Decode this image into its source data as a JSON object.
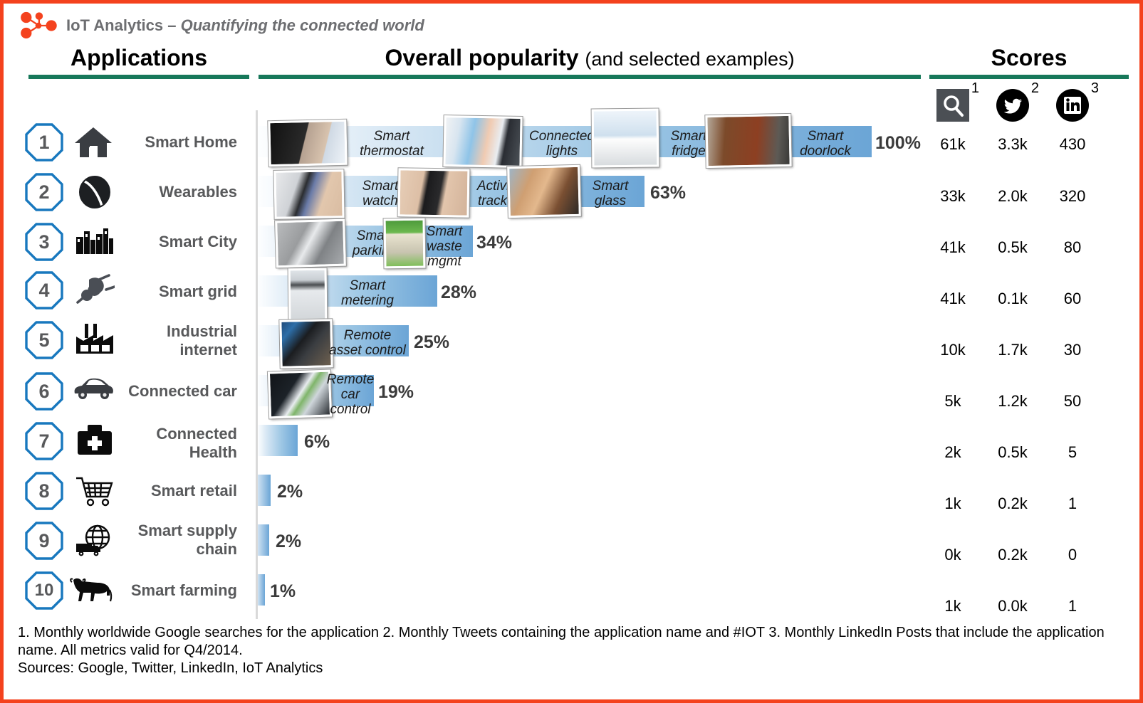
{
  "brand": {
    "logo_icon": "iot-analytics-node-logo",
    "name": "IoT Analytics – ",
    "tagline": "Quantifying the connected world"
  },
  "headers": {
    "applications": "Applications",
    "popularity_main": "Overall popularity",
    "popularity_sub": "(and selected examples)",
    "scores": "Scores"
  },
  "score_columns": [
    {
      "icon": "google-search-icon",
      "footnote": "1"
    },
    {
      "icon": "twitter-bird-icon",
      "footnote": "2"
    },
    {
      "icon": "linkedin-icon",
      "footnote": "3"
    }
  ],
  "chart_data": {
    "type": "bar",
    "title": "Overall popularity (and selected examples)",
    "xlabel": "",
    "ylabel": "",
    "xlim": [
      0,
      100
    ],
    "grid": false,
    "legend": "none",
    "categories": [
      "Smart Home",
      "Wearables",
      "Smart City",
      "Smart grid",
      "Industrial internet",
      "Connected car",
      "Connected Health",
      "Smart retail",
      "Smart supply chain",
      "Smart farming"
    ],
    "values": [
      100,
      63,
      34,
      28,
      25,
      19,
      6,
      2,
      2,
      1
    ],
    "value_labels": [
      "100%",
      "63%",
      "34%",
      "28%",
      "25%",
      "19%",
      "6%",
      "2%",
      "2%",
      "1%"
    ],
    "series": [
      {
        "name": "Google searches (monthly)",
        "values": [
          "61k",
          "33k",
          "41k",
          "41k",
          "10k",
          "5k",
          "2k",
          "1k",
          "0k",
          "1k"
        ]
      },
      {
        "name": "Tweets (monthly)",
        "values": [
          "3.3k",
          "2.0k",
          "0.5k",
          "0.1k",
          "1.7k",
          "1.2k",
          "0.5k",
          "0.2k",
          "0.2k",
          "0.0k"
        ]
      },
      {
        "name": "LinkedIn posts (monthly)",
        "values": [
          "430",
          "320",
          "80",
          "60",
          "30",
          "50",
          "5",
          "1",
          "0",
          "1"
        ]
      }
    ]
  },
  "rows": [
    {
      "rank": "1",
      "label": "Smart Home",
      "icon": "house-icon",
      "pct": "100%",
      "pct_value": 100,
      "scores": [
        "61k",
        "3.3k",
        "430"
      ],
      "examples": [
        {
          "label": "Smart\nthermostat",
          "photo": "smart-thermostat-photo"
        },
        {
          "label": "Connected\nlights",
          "photo": "connected-lights-photo"
        },
        {
          "label": "Smart\nfridge",
          "photo": "smart-fridge-photo"
        },
        {
          "label": "Smart\ndoorlock",
          "photo": "smart-doorlock-photo"
        }
      ]
    },
    {
      "rank": "2",
      "label": "Wearables",
      "icon": "smartwatch-band-icon",
      "pct": "63%",
      "pct_value": 63,
      "scores": [
        "33k",
        "2.0k",
        "320"
      ],
      "examples": [
        {
          "label": "Smart\nwatch",
          "photo": "smart-watch-photo"
        },
        {
          "label": "Activity\ntracker",
          "photo": "activity-tracker-photo"
        },
        {
          "label": "Smart\nglass",
          "photo": "smart-glass-photo"
        }
      ]
    },
    {
      "rank": "3",
      "label": "Smart City",
      "icon": "city-skyline-icon",
      "pct": "34%",
      "pct_value": 34,
      "scores": [
        "41k",
        "0.5k",
        "80"
      ],
      "examples": [
        {
          "label": "Smart\nparking",
          "photo": "smart-parking-photo"
        },
        {
          "label": "Smart\nwaste\nmgmt",
          "photo": "smart-waste-photo"
        }
      ]
    },
    {
      "rank": "4",
      "label": "Smart grid",
      "icon": "power-plug-icon",
      "pct": "28%",
      "pct_value": 28,
      "scores": [
        "41k",
        "0.1k",
        "60"
      ],
      "examples": [
        {
          "label": "Smart\nmetering",
          "photo": "smart-metering-photo"
        }
      ]
    },
    {
      "rank": "5",
      "label": "Industrial\ninternet",
      "icon": "factory-icon",
      "pct": "25%",
      "pct_value": 25,
      "scores": [
        "10k",
        "1.7k",
        "30"
      ],
      "examples": [
        {
          "label": "Remote\nasset control",
          "photo": "remote-asset-control-photo"
        }
      ]
    },
    {
      "rank": "6",
      "label": "Connected car",
      "icon": "car-icon",
      "pct": "19%",
      "pct_value": 19,
      "scores": [
        "5k",
        "1.2k",
        "50"
      ],
      "examples": [
        {
          "label": "Remote\ncar\ncontrol",
          "photo": "remote-car-control-photo"
        }
      ]
    },
    {
      "rank": "7",
      "label": "Connected\nHealth",
      "icon": "medical-kit-icon",
      "pct": "6%",
      "pct_value": 6,
      "scores": [
        "2k",
        "0.5k",
        "5"
      ],
      "examples": []
    },
    {
      "rank": "8",
      "label": "Smart retail",
      "icon": "shopping-cart-icon",
      "pct": "2%",
      "pct_value": 2,
      "scores": [
        "1k",
        "0.2k",
        "1"
      ],
      "examples": []
    },
    {
      "rank": "9",
      "label": "Smart supply\nchain",
      "icon": "globe-truck-icon",
      "pct": "2%",
      "pct_value": 2,
      "scores": [
        "0k",
        "0.2k",
        "0"
      ],
      "examples": []
    },
    {
      "rank": "10",
      "label": "Smart farming",
      "icon": "cow-icon",
      "pct": "1%",
      "pct_value": 1,
      "scores": [
        "1k",
        "0.0k",
        "1"
      ],
      "examples": []
    }
  ],
  "footnote": {
    "line1": "1. Monthly worldwide Google searches for the application  2. Monthly Tweets containing the application name and #IOT  3. Monthly LinkedIn Posts that include the application name.  All metrics valid for Q4/2014.",
    "line2": "Sources: Google, Twitter, LinkedIn, IoT Analytics"
  },
  "colors": {
    "frame": "#f4421e",
    "rule_green": "#17785a",
    "badge_blue": "#1878be",
    "bar_blue": "#6ba5d6",
    "label_gray": "#58595b"
  }
}
